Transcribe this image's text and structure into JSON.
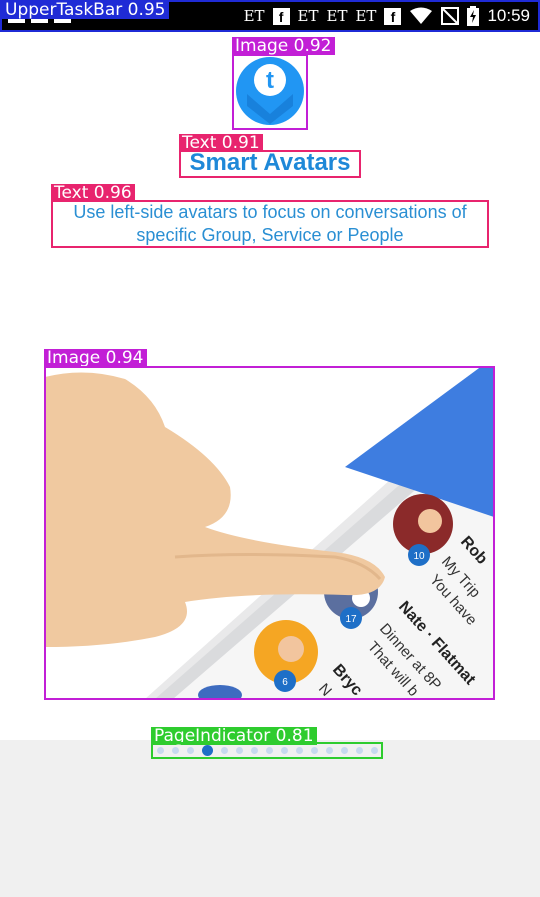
{
  "status_bar": {
    "carrier_items": [
      "ET",
      "ET",
      "ET",
      "ET"
    ],
    "time": "10:59"
  },
  "overlay_labels": {
    "status_bar": "UpperTaskBar 0.95",
    "logo": "Image 0.92",
    "title": "Text 0.91",
    "desc": "Text 0.96",
    "illustration": "Image 0.94",
    "indicator": "PageIndicator 0.81"
  },
  "onboarding": {
    "title": "Smart Avatars",
    "description": "Use left-side avatars to focus on conversations of specific Group, Service or People",
    "illustration_texts": {
      "name_1": "Rob",
      "msg_1a": "My Trip",
      "msg_1b": "You have",
      "name_2": "Nate · Flatmat",
      "msg_2a": "Dinner at 8P",
      "msg_2b": "That will b",
      "name_3": "Bryc",
      "msg_3": "N",
      "badge_1": "10",
      "badge_2": "17",
      "badge_3": "6"
    }
  },
  "page_indicator": {
    "total": 15,
    "active_index": 3
  },
  "colors": {
    "accent": "#1e88d8",
    "dot_active": "#1e6fc7",
    "dot_inactive": "#c7d9ee",
    "tag_magenta": "#c21fd6",
    "tag_pink": "#e8246e",
    "tag_green": "#2ecc2e",
    "tag_blue": "#1f2bd6"
  }
}
